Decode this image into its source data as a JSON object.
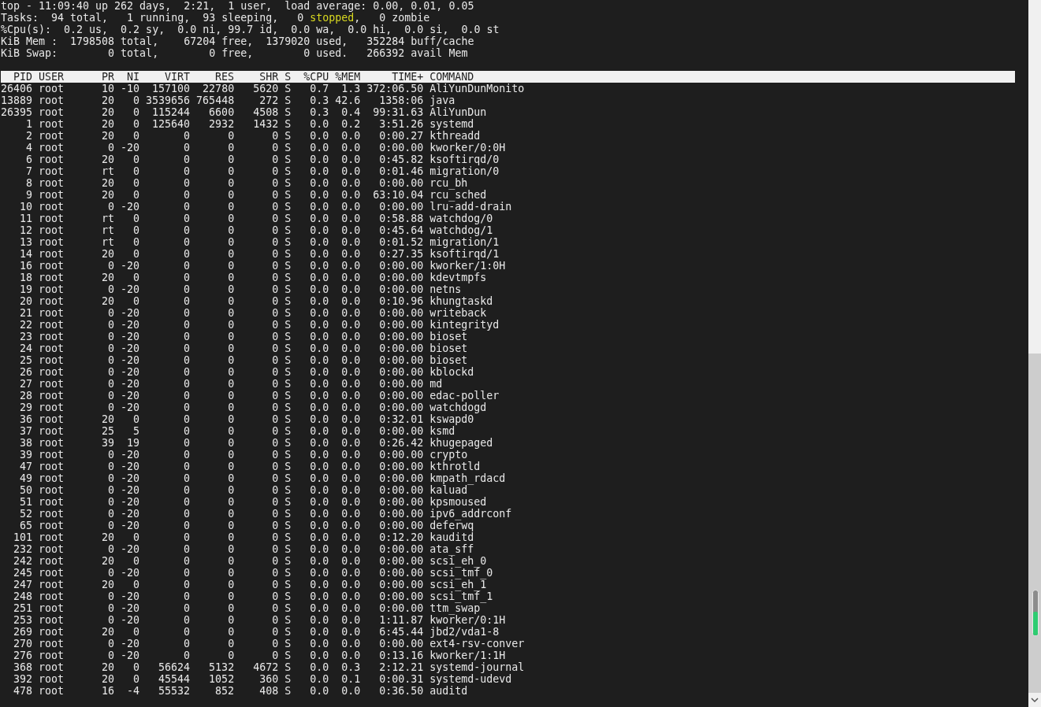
{
  "summary": [
    {
      "segments": [
        {
          "text": "top - 11:09:40 up 262 days,  2:21,  1 user,  load average: 0.00, 0.01, 0.05",
          "highlight": false
        }
      ]
    },
    {
      "segments": [
        {
          "text": "Tasks:  94 total,   1 running,  93 sleeping,   0 ",
          "highlight": false
        },
        {
          "text": "stopped",
          "highlight": true
        },
        {
          "text": ",   0 zombie",
          "highlight": false
        }
      ]
    },
    {
      "segments": [
        {
          "text": "%Cpu(s):  0.2 us,  0.2 sy,  0.0 ni, 99.7 id,  0.0 wa,  0.0 hi,  0.0 si,  0.0 st",
          "highlight": false
        }
      ]
    },
    {
      "segments": [
        {
          "text": "KiB Mem :  1798508 total,    67204 free,  1379020 used,   352284 buff/cache",
          "highlight": false
        }
      ]
    },
    {
      "segments": [
        {
          "text": "KiB Swap:        0 total,        0 free,        0 used.   266392 avail Mem",
          "highlight": false
        }
      ]
    }
  ],
  "table": {
    "columns": [
      "PID",
      "USER",
      "PR",
      "NI",
      "VIRT",
      "RES",
      "SHR",
      "S",
      "%CPU",
      "%MEM",
      "TIME+",
      "COMMAND"
    ],
    "rows": [
      [
        "26406",
        "root",
        "10",
        "-10",
        "157100",
        "22780",
        "5620",
        "S",
        "0.7",
        "1.3",
        "372:06.50",
        "AliYunDunMonito"
      ],
      [
        "13889",
        "root",
        "20",
        "0",
        "3539656",
        "765448",
        "272",
        "S",
        "0.3",
        "42.6",
        "1358:06",
        "java"
      ],
      [
        "26395",
        "root",
        "20",
        "0",
        "115244",
        "6600",
        "4508",
        "S",
        "0.3",
        "0.4",
        "99:31.63",
        "AliYunDun"
      ],
      [
        "1",
        "root",
        "20",
        "0",
        "125640",
        "2932",
        "1432",
        "S",
        "0.0",
        "0.2",
        "3:51.26",
        "systemd"
      ],
      [
        "2",
        "root",
        "20",
        "0",
        "0",
        "0",
        "0",
        "S",
        "0.0",
        "0.0",
        "0:00.27",
        "kthreadd"
      ],
      [
        "4",
        "root",
        "0",
        "-20",
        "0",
        "0",
        "0",
        "S",
        "0.0",
        "0.0",
        "0:00.00",
        "kworker/0:0H"
      ],
      [
        "6",
        "root",
        "20",
        "0",
        "0",
        "0",
        "0",
        "S",
        "0.0",
        "0.0",
        "0:45.82",
        "ksoftirqd/0"
      ],
      [
        "7",
        "root",
        "rt",
        "0",
        "0",
        "0",
        "0",
        "S",
        "0.0",
        "0.0",
        "0:01.46",
        "migration/0"
      ],
      [
        "8",
        "root",
        "20",
        "0",
        "0",
        "0",
        "0",
        "S",
        "0.0",
        "0.0",
        "0:00.00",
        "rcu_bh"
      ],
      [
        "9",
        "root",
        "20",
        "0",
        "0",
        "0",
        "0",
        "S",
        "0.0",
        "0.0",
        "63:10.04",
        "rcu_sched"
      ],
      [
        "10",
        "root",
        "0",
        "-20",
        "0",
        "0",
        "0",
        "S",
        "0.0",
        "0.0",
        "0:00.00",
        "lru-add-drain"
      ],
      [
        "11",
        "root",
        "rt",
        "0",
        "0",
        "0",
        "0",
        "S",
        "0.0",
        "0.0",
        "0:58.88",
        "watchdog/0"
      ],
      [
        "12",
        "root",
        "rt",
        "0",
        "0",
        "0",
        "0",
        "S",
        "0.0",
        "0.0",
        "0:45.64",
        "watchdog/1"
      ],
      [
        "13",
        "root",
        "rt",
        "0",
        "0",
        "0",
        "0",
        "S",
        "0.0",
        "0.0",
        "0:01.52",
        "migration/1"
      ],
      [
        "14",
        "root",
        "20",
        "0",
        "0",
        "0",
        "0",
        "S",
        "0.0",
        "0.0",
        "0:27.35",
        "ksoftirqd/1"
      ],
      [
        "16",
        "root",
        "0",
        "-20",
        "0",
        "0",
        "0",
        "S",
        "0.0",
        "0.0",
        "0:00.00",
        "kworker/1:0H"
      ],
      [
        "18",
        "root",
        "20",
        "0",
        "0",
        "0",
        "0",
        "S",
        "0.0",
        "0.0",
        "0:00.00",
        "kdevtmpfs"
      ],
      [
        "19",
        "root",
        "0",
        "-20",
        "0",
        "0",
        "0",
        "S",
        "0.0",
        "0.0",
        "0:00.00",
        "netns"
      ],
      [
        "20",
        "root",
        "20",
        "0",
        "0",
        "0",
        "0",
        "S",
        "0.0",
        "0.0",
        "0:10.96",
        "khungtaskd"
      ],
      [
        "21",
        "root",
        "0",
        "-20",
        "0",
        "0",
        "0",
        "S",
        "0.0",
        "0.0",
        "0:00.00",
        "writeback"
      ],
      [
        "22",
        "root",
        "0",
        "-20",
        "0",
        "0",
        "0",
        "S",
        "0.0",
        "0.0",
        "0:00.00",
        "kintegrityd"
      ],
      [
        "23",
        "root",
        "0",
        "-20",
        "0",
        "0",
        "0",
        "S",
        "0.0",
        "0.0",
        "0:00.00",
        "bioset"
      ],
      [
        "24",
        "root",
        "0",
        "-20",
        "0",
        "0",
        "0",
        "S",
        "0.0",
        "0.0",
        "0:00.00",
        "bioset"
      ],
      [
        "25",
        "root",
        "0",
        "-20",
        "0",
        "0",
        "0",
        "S",
        "0.0",
        "0.0",
        "0:00.00",
        "bioset"
      ],
      [
        "26",
        "root",
        "0",
        "-20",
        "0",
        "0",
        "0",
        "S",
        "0.0",
        "0.0",
        "0:00.00",
        "kblockd"
      ],
      [
        "27",
        "root",
        "0",
        "-20",
        "0",
        "0",
        "0",
        "S",
        "0.0",
        "0.0",
        "0:00.00",
        "md"
      ],
      [
        "28",
        "root",
        "0",
        "-20",
        "0",
        "0",
        "0",
        "S",
        "0.0",
        "0.0",
        "0:00.00",
        "edac-poller"
      ],
      [
        "29",
        "root",
        "0",
        "-20",
        "0",
        "0",
        "0",
        "S",
        "0.0",
        "0.0",
        "0:00.00",
        "watchdogd"
      ],
      [
        "36",
        "root",
        "20",
        "0",
        "0",
        "0",
        "0",
        "S",
        "0.0",
        "0.0",
        "0:32.01",
        "kswapd0"
      ],
      [
        "37",
        "root",
        "25",
        "5",
        "0",
        "0",
        "0",
        "S",
        "0.0",
        "0.0",
        "0:00.00",
        "ksmd"
      ],
      [
        "38",
        "root",
        "39",
        "19",
        "0",
        "0",
        "0",
        "S",
        "0.0",
        "0.0",
        "0:26.42",
        "khugepaged"
      ],
      [
        "39",
        "root",
        "0",
        "-20",
        "0",
        "0",
        "0",
        "S",
        "0.0",
        "0.0",
        "0:00.00",
        "crypto"
      ],
      [
        "47",
        "root",
        "0",
        "-20",
        "0",
        "0",
        "0",
        "S",
        "0.0",
        "0.0",
        "0:00.00",
        "kthrotld"
      ],
      [
        "49",
        "root",
        "0",
        "-20",
        "0",
        "0",
        "0",
        "S",
        "0.0",
        "0.0",
        "0:00.00",
        "kmpath_rdacd"
      ],
      [
        "50",
        "root",
        "0",
        "-20",
        "0",
        "0",
        "0",
        "S",
        "0.0",
        "0.0",
        "0:00.00",
        "kaluad"
      ],
      [
        "51",
        "root",
        "0",
        "-20",
        "0",
        "0",
        "0",
        "S",
        "0.0",
        "0.0",
        "0:00.00",
        "kpsmoused"
      ],
      [
        "52",
        "root",
        "0",
        "-20",
        "0",
        "0",
        "0",
        "S",
        "0.0",
        "0.0",
        "0:00.00",
        "ipv6_addrconf"
      ],
      [
        "65",
        "root",
        "0",
        "-20",
        "0",
        "0",
        "0",
        "S",
        "0.0",
        "0.0",
        "0:00.00",
        "deferwq"
      ],
      [
        "101",
        "root",
        "20",
        "0",
        "0",
        "0",
        "0",
        "S",
        "0.0",
        "0.0",
        "0:12.20",
        "kauditd"
      ],
      [
        "232",
        "root",
        "0",
        "-20",
        "0",
        "0",
        "0",
        "S",
        "0.0",
        "0.0",
        "0:00.00",
        "ata_sff"
      ],
      [
        "242",
        "root",
        "20",
        "0",
        "0",
        "0",
        "0",
        "S",
        "0.0",
        "0.0",
        "0:00.00",
        "scsi_eh_0"
      ],
      [
        "245",
        "root",
        "0",
        "-20",
        "0",
        "0",
        "0",
        "S",
        "0.0",
        "0.0",
        "0:00.00",
        "scsi_tmf_0"
      ],
      [
        "247",
        "root",
        "20",
        "0",
        "0",
        "0",
        "0",
        "S",
        "0.0",
        "0.0",
        "0:00.00",
        "scsi_eh_1"
      ],
      [
        "248",
        "root",
        "0",
        "-20",
        "0",
        "0",
        "0",
        "S",
        "0.0",
        "0.0",
        "0:00.00",
        "scsi_tmf_1"
      ],
      [
        "251",
        "root",
        "0",
        "-20",
        "0",
        "0",
        "0",
        "S",
        "0.0",
        "0.0",
        "0:00.00",
        "ttm_swap"
      ],
      [
        "253",
        "root",
        "0",
        "-20",
        "0",
        "0",
        "0",
        "S",
        "0.0",
        "0.0",
        "1:11.87",
        "kworker/0:1H"
      ],
      [
        "269",
        "root",
        "20",
        "0",
        "0",
        "0",
        "0",
        "S",
        "0.0",
        "0.0",
        "6:45.44",
        "jbd2/vda1-8"
      ],
      [
        "270",
        "root",
        "0",
        "-20",
        "0",
        "0",
        "0",
        "S",
        "0.0",
        "0.0",
        "0:00.00",
        "ext4-rsv-conver"
      ],
      [
        "276",
        "root",
        "0",
        "-20",
        "0",
        "0",
        "0",
        "S",
        "0.0",
        "0.0",
        "0:13.16",
        "kworker/1:1H"
      ],
      [
        "368",
        "root",
        "20",
        "0",
        "56624",
        "5132",
        "4672",
        "S",
        "0.0",
        "0.3",
        "2:12.21",
        "systemd-journal"
      ],
      [
        "392",
        "root",
        "20",
        "0",
        "45544",
        "1052",
        "360",
        "S",
        "0.0",
        "0.1",
        "0:00.31",
        "systemd-udevd"
      ],
      [
        "478",
        "root",
        "16",
        "-4",
        "55532",
        "852",
        "408",
        "S",
        "0.0",
        "0.0",
        "0:36.50",
        "auditd"
      ]
    ]
  }
}
